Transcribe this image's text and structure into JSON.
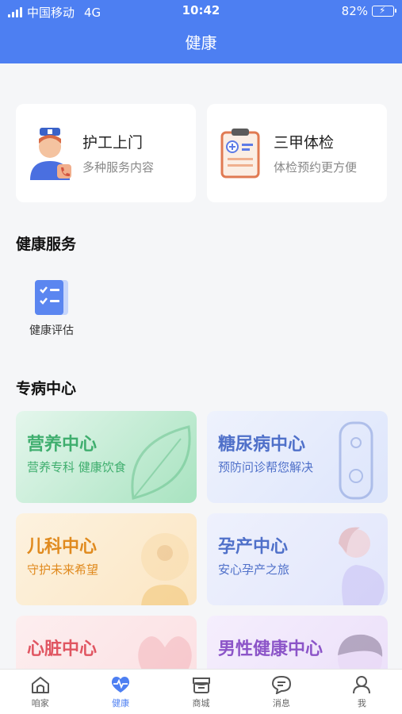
{
  "status": {
    "carrier": "中国移动",
    "network": "4G",
    "time": "10:42",
    "battery": "82%",
    "battery_level": 0.82
  },
  "header": {
    "title": "健康"
  },
  "top_cards": [
    {
      "title": "护工上门",
      "subtitle": "多种服务内容",
      "icon": "nurse-icon"
    },
    {
      "title": "三甲体检",
      "subtitle": "体检预约更方便",
      "icon": "clipboard-icon"
    }
  ],
  "health_services": {
    "title": "健康服务",
    "items": [
      {
        "label": "健康评估",
        "icon": "checklist-icon"
      }
    ]
  },
  "specialty": {
    "title": "专病中心",
    "tiles": [
      {
        "title": "营养中心",
        "subtitle": "营养专科 健康饮食",
        "color": "#3fae6e"
      },
      {
        "title": "糖尿病中心",
        "subtitle": "预防问诊帮您解决",
        "color": "#4f70c9"
      },
      {
        "title": "儿科中心",
        "subtitle": "守护未来希望",
        "color": "#e08a1e"
      },
      {
        "title": "孕产中心",
        "subtitle": "安心孕产之旅",
        "color": "#4f70c9"
      },
      {
        "title": "心脏中心",
        "subtitle": "",
        "color": "#e05561"
      },
      {
        "title": "男性健康中心",
        "subtitle": "",
        "color": "#8c55c8"
      }
    ]
  },
  "tabbar": {
    "items": [
      {
        "label": "咱家",
        "icon": "home-icon"
      },
      {
        "label": "健康",
        "icon": "heart-pulse-icon",
        "active": true
      },
      {
        "label": "商城",
        "icon": "store-icon"
      },
      {
        "label": "消息",
        "icon": "message-icon"
      },
      {
        "label": "我",
        "icon": "profile-icon"
      }
    ]
  },
  "colors": {
    "primary": "#4d7ff2",
    "background": "#f5f6f8"
  }
}
